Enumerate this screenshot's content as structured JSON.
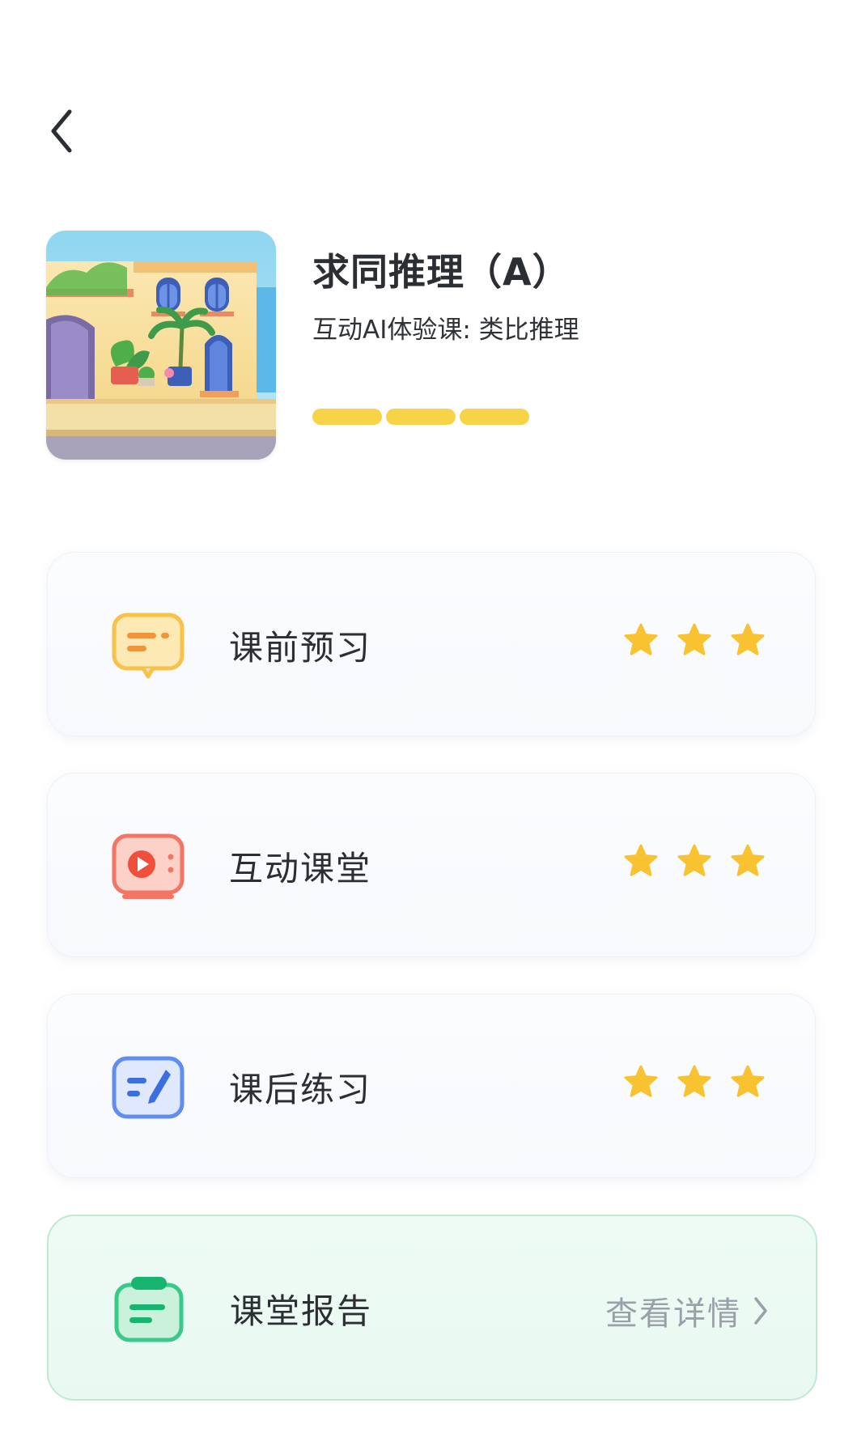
{
  "header": {
    "back_icon": "chevron-left-icon"
  },
  "course": {
    "title": "求同推理（A）",
    "subtitle": "互动AI体验课: 类比推理",
    "progress_filled": 3,
    "progress_total": 3,
    "progress_color": "#f7d447"
  },
  "sections": [
    {
      "label": "课前预习",
      "icon": "preview-chat-icon",
      "stars": 3,
      "accent": "#f8c24a"
    },
    {
      "label": "互动课堂",
      "icon": "video-play-icon",
      "stars": 3,
      "accent": "#f27663"
    },
    {
      "label": "课后练习",
      "icon": "practice-pen-icon",
      "stars": 3,
      "accent": "#5f8ef0"
    }
  ],
  "report": {
    "label": "课堂报告",
    "icon": "report-clipboard-icon",
    "detail_label": "查看详情",
    "accent": "#39c98a"
  },
  "colors": {
    "star": "#f8c230",
    "text": "#2b2e33",
    "muted": "#9aa0a8"
  }
}
